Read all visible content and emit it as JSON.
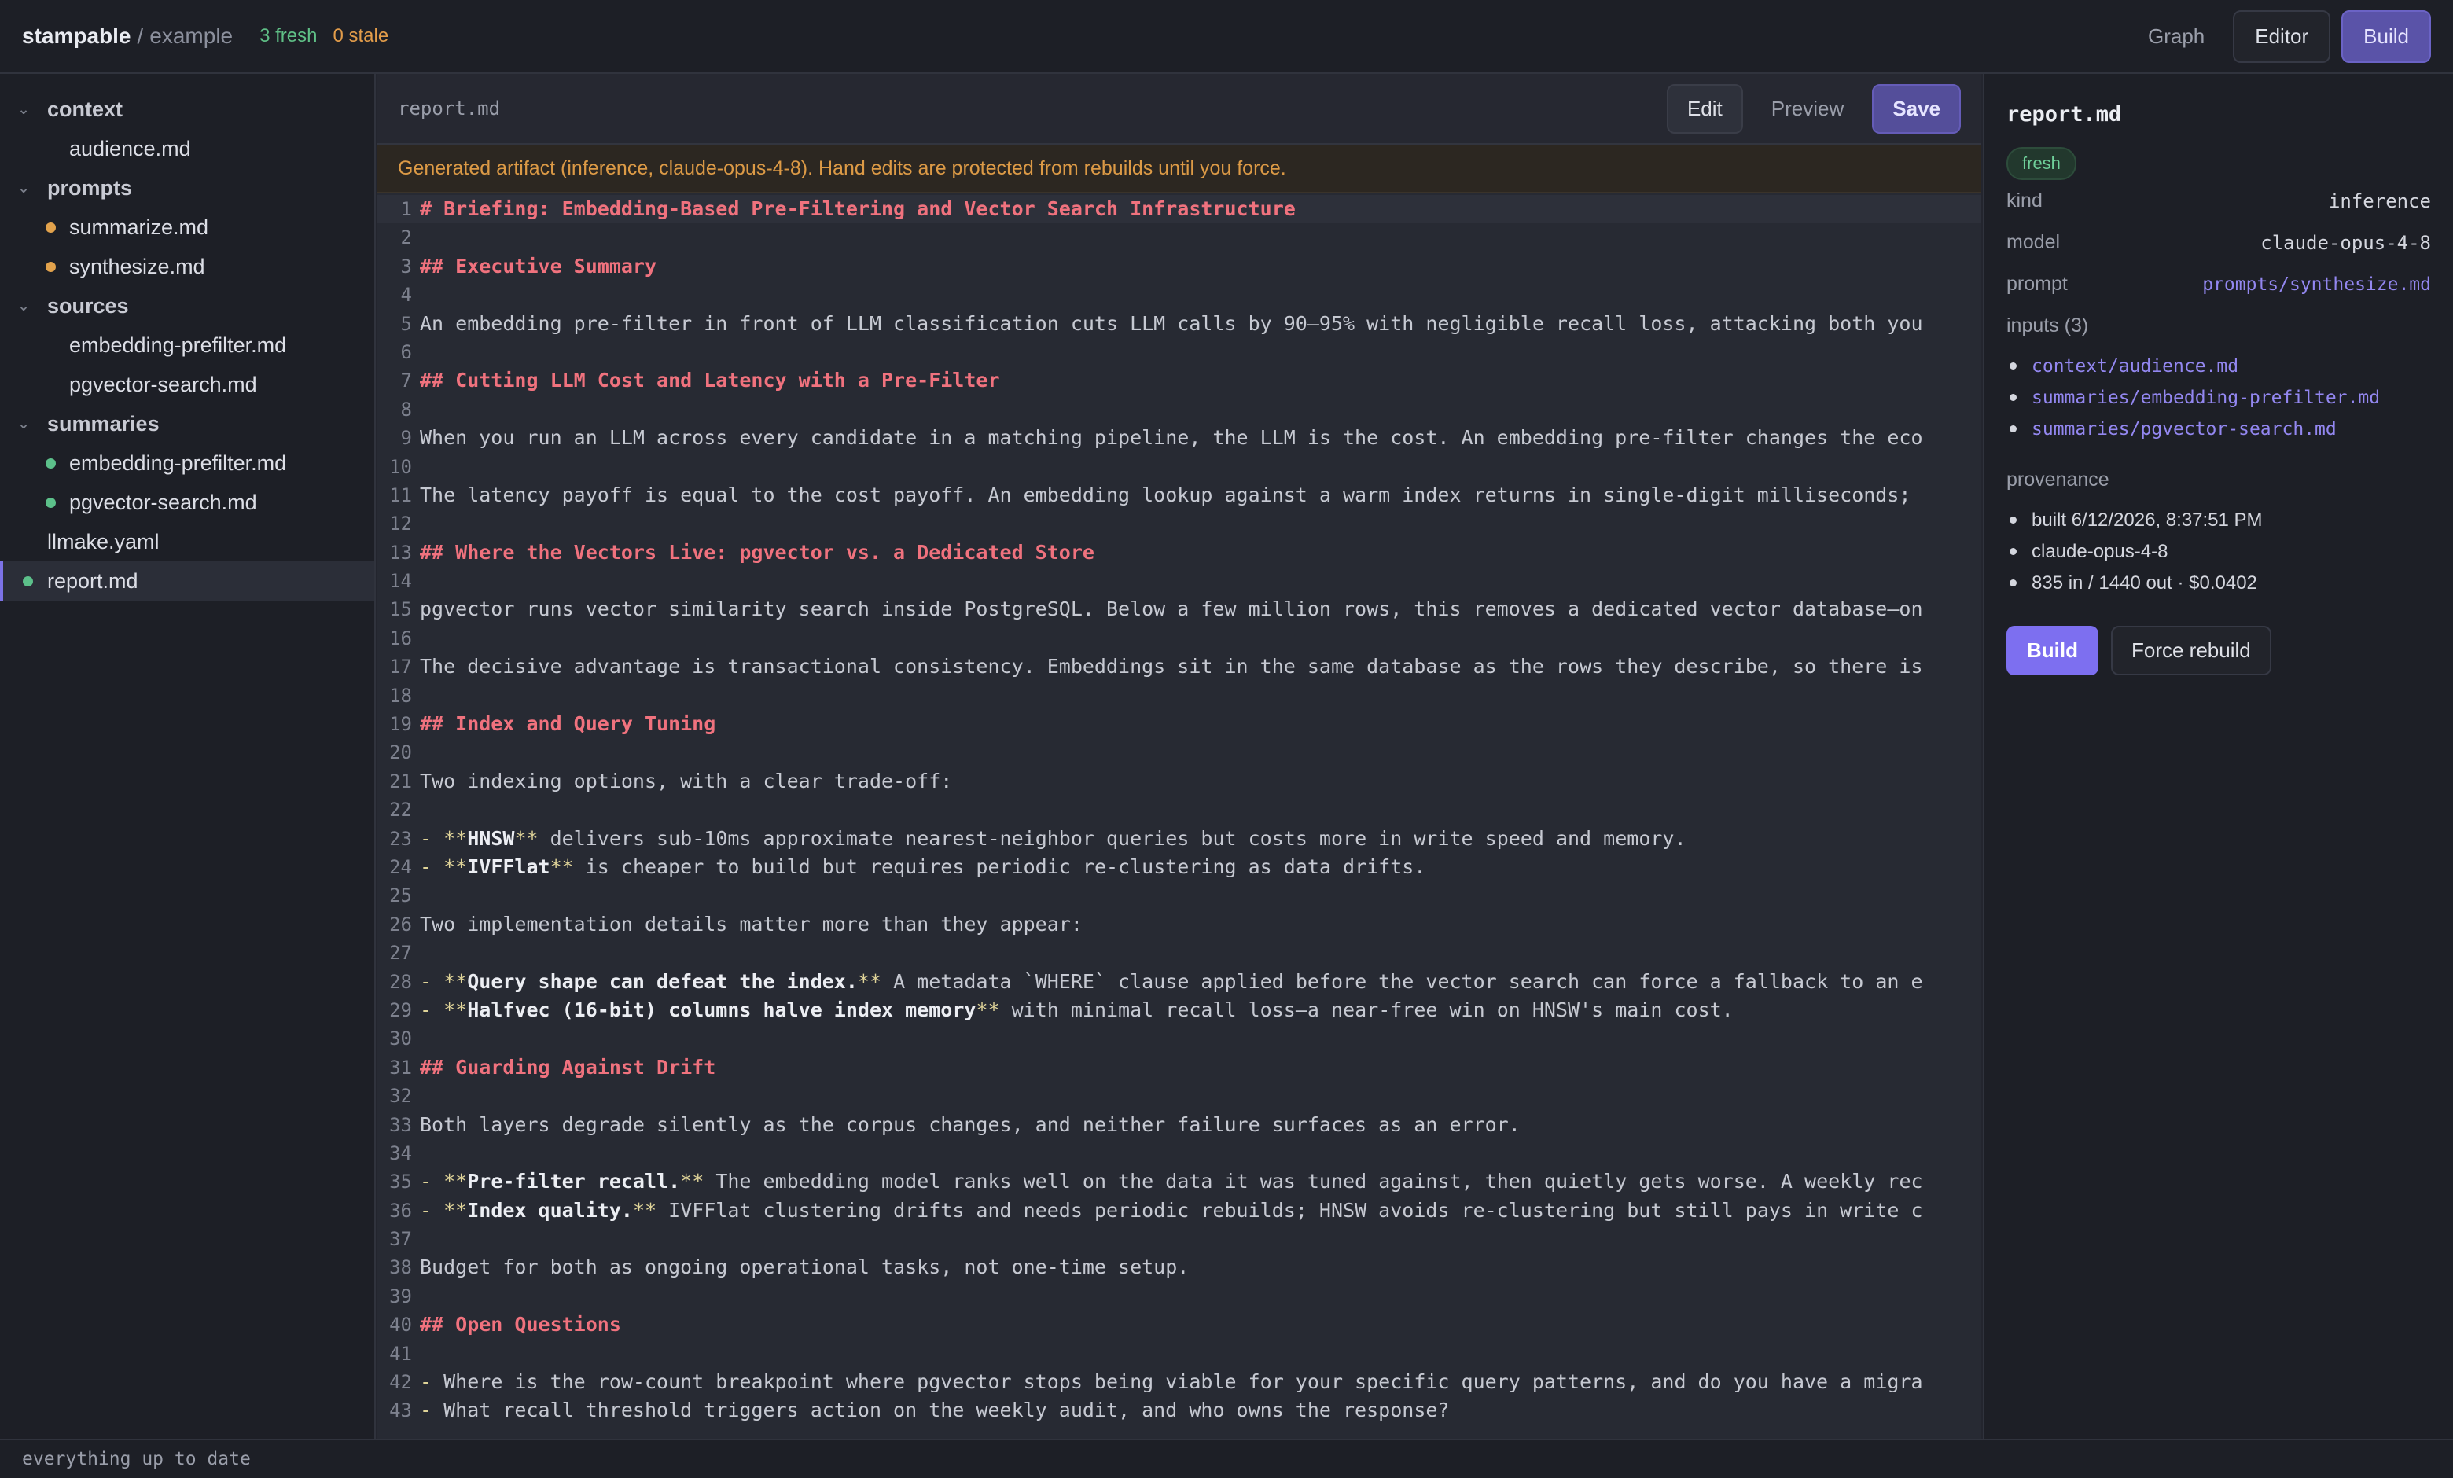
{
  "topbar": {
    "brand": "stampable",
    "separator": "/",
    "project": "example",
    "fresh_count": "3 fresh",
    "stale_count": "0 stale",
    "graph_label": "Graph",
    "editor_label": "Editor",
    "build_label": "Build"
  },
  "sidebar": {
    "tree": [
      {
        "kind": "folder",
        "label": "context"
      },
      {
        "kind": "file",
        "label": "audience.md",
        "status": ""
      },
      {
        "kind": "folder",
        "label": "prompts"
      },
      {
        "kind": "file",
        "label": "summarize.md",
        "status": "stale"
      },
      {
        "kind": "file",
        "label": "synthesize.md",
        "status": "stale"
      },
      {
        "kind": "folder",
        "label": "sources"
      },
      {
        "kind": "file",
        "label": "embedding-prefilter.md",
        "status": ""
      },
      {
        "kind": "file",
        "label": "pgvector-search.md",
        "status": ""
      },
      {
        "kind": "folder",
        "label": "summaries"
      },
      {
        "kind": "file",
        "label": "embedding-prefilter.md",
        "status": "fresh"
      },
      {
        "kind": "file",
        "label": "pgvector-search.md",
        "status": "fresh"
      },
      {
        "kind": "root",
        "label": "llmake.yaml",
        "status": ""
      },
      {
        "kind": "root",
        "label": "report.md",
        "status": "fresh",
        "active": true
      }
    ]
  },
  "editor": {
    "filename": "report.md",
    "edit_label": "Edit",
    "preview_label": "Preview",
    "save_label": "Save",
    "banner": "Generated artifact (inference, claude-opus-4-8). Hand edits are protected from rebuilds until you force.",
    "lines": [
      [
        {
          "t": "# Briefing: Embedding-Based Pre-Filtering and Vector Search Infrastructure",
          "c": "heading"
        }
      ],
      [],
      [
        {
          "t": "## Executive Summary",
          "c": "heading"
        }
      ],
      [],
      [
        {
          "t": "An embedding pre-filter in front of LLM classification cuts LLM calls by 90–95% with negligible recall loss, attacking both you",
          "c": ""
        }
      ],
      [],
      [
        {
          "t": "## Cutting LLM Cost and Latency with a Pre-Filter",
          "c": "heading"
        }
      ],
      [],
      [
        {
          "t": "When you run an LLM across every candidate in a matching pipeline, the LLM is the cost. An embedding pre-filter changes the eco",
          "c": ""
        }
      ],
      [],
      [
        {
          "t": "The latency payoff is equal to the cost payoff. An embedding lookup against a warm index returns in single-digit milliseconds;",
          "c": ""
        }
      ],
      [],
      [
        {
          "t": "## Where the Vectors Live: pgvector vs. a Dedicated Store",
          "c": "heading"
        }
      ],
      [],
      [
        {
          "t": "pgvector runs vector similarity search inside PostgreSQL. Below a few million rows, this removes a dedicated vector database—on",
          "c": ""
        }
      ],
      [],
      [
        {
          "t": "The decisive advantage is transactional consistency. Embeddings sit in the same database as the rows they describe, so there is",
          "c": ""
        }
      ],
      [],
      [
        {
          "t": "## Index and Query Tuning",
          "c": "heading"
        }
      ],
      [],
      [
        {
          "t": "Two indexing options, with a clear trade-off:",
          "c": ""
        }
      ],
      [],
      [
        {
          "t": "- **",
          "c": "bullet"
        },
        {
          "t": "HNSW",
          "c": "bold"
        },
        {
          "t": "**",
          "c": "bullet"
        },
        {
          "t": " delivers sub-10ms approximate nearest-neighbor queries but costs more in write speed and memory.",
          "c": ""
        }
      ],
      [
        {
          "t": "- **",
          "c": "bullet"
        },
        {
          "t": "IVFFlat",
          "c": "bold"
        },
        {
          "t": "**",
          "c": "bullet"
        },
        {
          "t": " is cheaper to build but requires periodic re-clustering as data drifts.",
          "c": ""
        }
      ],
      [],
      [
        {
          "t": "Two implementation details matter more than they appear:",
          "c": ""
        }
      ],
      [],
      [
        {
          "t": "- **",
          "c": "bullet"
        },
        {
          "t": "Query shape can defeat the index.",
          "c": "bold"
        },
        {
          "t": "**",
          "c": "bullet"
        },
        {
          "t": " A metadata `WHERE` clause applied before the vector search can force a fallback to an e",
          "c": ""
        }
      ],
      [
        {
          "t": "- **",
          "c": "bullet"
        },
        {
          "t": "Halfvec (16-bit) columns halve index memory",
          "c": "bold"
        },
        {
          "t": "**",
          "c": "bullet"
        },
        {
          "t": " with minimal recall loss—a near-free win on HNSW's main cost.",
          "c": ""
        }
      ],
      [],
      [
        {
          "t": "## Guarding Against Drift",
          "c": "heading"
        }
      ],
      [],
      [
        {
          "t": "Both layers degrade silently as the corpus changes, and neither failure surfaces as an error.",
          "c": ""
        }
      ],
      [],
      [
        {
          "t": "- **",
          "c": "bullet"
        },
        {
          "t": "Pre-filter recall.",
          "c": "bold"
        },
        {
          "t": "**",
          "c": "bullet"
        },
        {
          "t": " The embedding model ranks well on the data it was tuned against, then quietly gets worse. A weekly rec",
          "c": ""
        }
      ],
      [
        {
          "t": "- **",
          "c": "bullet"
        },
        {
          "t": "Index quality.",
          "c": "bold"
        },
        {
          "t": "**",
          "c": "bullet"
        },
        {
          "t": " IVFFlat clustering drifts and needs periodic rebuilds; HNSW avoids re-clustering but still pays in write c",
          "c": ""
        }
      ],
      [],
      [
        {
          "t": "Budget for both as ongoing operational tasks, not one-time setup.",
          "c": ""
        }
      ],
      [],
      [
        {
          "t": "## Open Questions",
          "c": "heading"
        }
      ],
      [],
      [
        {
          "t": "- ",
          "c": "bullet"
        },
        {
          "t": "Where is the row-count breakpoint where pgvector stops being viable for your specific query patterns, and do you have a migra",
          "c": ""
        }
      ],
      [
        {
          "t": "- ",
          "c": "bullet"
        },
        {
          "t": "What recall threshold triggers action on the weekly audit, and who owns the response?",
          "c": ""
        }
      ]
    ]
  },
  "panel": {
    "title": "report.md",
    "badge": "fresh",
    "kind_label": "kind",
    "kind_value": "inference",
    "model_label": "model",
    "model_value": "claude-opus-4-8",
    "prompt_label": "prompt",
    "prompt_value": "prompts/synthesize.md",
    "inputs_label": "inputs (3)",
    "inputs": [
      "context/audience.md",
      "summaries/embedding-prefilter.md",
      "summaries/pgvector-search.md"
    ],
    "provenance_label": "provenance",
    "provenance": [
      "built 6/12/2026, 8:37:51 PM",
      "claude-opus-4-8",
      "835 in / 1440 out · $0.0402"
    ],
    "build_label": "Build",
    "force_label": "Force rebuild"
  },
  "statusbar": {
    "text": "everything up to date"
  }
}
